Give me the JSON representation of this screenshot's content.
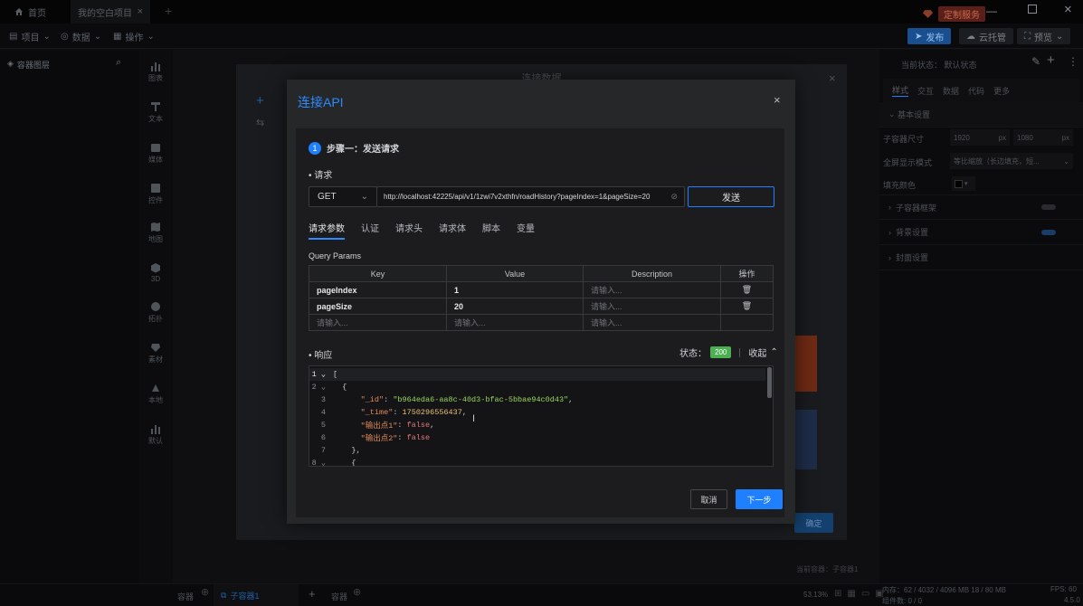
{
  "window": {
    "tabs": [
      {
        "label": "首页",
        "icon": "home-icon"
      },
      {
        "label": "我的空白项目",
        "icon": "close-icon"
      }
    ],
    "custom_service": "定制服务",
    "controls": [
      "minimize-icon",
      "restore-icon",
      "close-icon"
    ]
  },
  "menubar": {
    "items": [
      "项目",
      "数据",
      "操作"
    ],
    "publish": "发布",
    "cloud": "云托管",
    "preview": "预览"
  },
  "layer_panel": {
    "title": "容器图层"
  },
  "toolbar": {
    "items": [
      "图表",
      "文本",
      "媒体",
      "控件",
      "地图",
      "3D",
      "拓扑",
      "素材",
      "本地",
      "默认"
    ]
  },
  "right_panel": {
    "state_label": "当前状态：",
    "state_value": "默认状态",
    "tabs": [
      "样式",
      "交互",
      "数据",
      "代码",
      "更多"
    ],
    "section_basic": "基本设置",
    "size_label": "子容器尺寸",
    "width": "1920",
    "height": "1080",
    "unit": "px",
    "fullscreen_label": "全屏显示模式",
    "fullscreen_value": "等比缩放（长边填充，短...",
    "fill_label": "填充颜色",
    "section_container": "子容器框架",
    "section_bg": "背景设置",
    "section_cover": "封面设置"
  },
  "bg_dialog": {
    "title": "连接数据",
    "confirm": "确定",
    "add_icon": "plus-icon",
    "swap_icon": "swap-icon"
  },
  "modal": {
    "title": "连接API",
    "step_num": "1",
    "step_label": "步骤一：发送请求",
    "request_label": "请求",
    "method": "GET",
    "url": "http://localhost:42225/api/v1/1zwi7v2xthfn/roadHistory?pageIndex=1&pageSize=20",
    "send": "发送",
    "tabs": [
      "请求参数",
      "认证",
      "请求头",
      "请求体",
      "脚本",
      "变量"
    ],
    "query_params_label": "Query Params",
    "table": {
      "headers": [
        "Key",
        "Value",
        "Description",
        "操作"
      ],
      "rows": [
        {
          "key": "pageIndex",
          "value": "1",
          "desc": "请输入..."
        },
        {
          "key": "pageSize",
          "value": "20",
          "desc": "请输入..."
        }
      ],
      "placeholder": "请输入..."
    },
    "response_label": "响应",
    "status_label": "状态：",
    "status_code": "200",
    "collapse": "收起",
    "code": {
      "l1": "[",
      "l2": "{",
      "l3_key": "\"_id\"",
      "l3_val": "\"b964eda6-aa8c-40d3-bfac-5bbae94c0d43\"",
      "l4_key": "\"_time\"",
      "l4_val": "1750296556437",
      "l5_key": "\"输出点1\"",
      "l5_val": "false",
      "l6_key": "\"输出点2\"",
      "l6_val": "false",
      "l7": "},",
      "l8": "{"
    },
    "cancel": "取消",
    "next": "下一步"
  },
  "statusbar": {
    "tab1": "容器",
    "tab2": "子容器1",
    "tab3": "容器",
    "zoom": "53.13%",
    "memory": "内存：62 / 4032 / 4096 MB 18 / 80 MB",
    "fps": "FPS: 60",
    "components": "组件数: 0 / 0",
    "version": "4.5.0",
    "current_container_label": "当前容器：",
    "current_container_value": "子容器1"
  },
  "colors": {
    "accent": "#1e80ff",
    "status_ok": "#4caf50",
    "bg": "#0e0e10"
  }
}
